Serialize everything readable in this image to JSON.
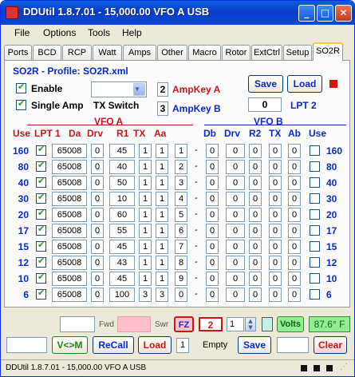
{
  "window": {
    "title": "DDUtil 1.8.7.01 - 15,000.00  VFO A  USB",
    "min": "_",
    "max": "□",
    "close": "✕"
  },
  "menu": [
    "File",
    "Options",
    "Tools",
    "Help"
  ],
  "tabs": [
    "Ports",
    "BCD",
    "RCP",
    "Watt",
    "Amps",
    "Other",
    "Macro",
    "Rotor",
    "ExtCtrl",
    "Setup",
    "SO2R"
  ],
  "so2r": {
    "profile": "SO2R - Profile: SO2R.xml",
    "enable": "Enable",
    "single_amp": "Single Amp",
    "tx_switch": "TX Switch",
    "ampkey_a_num": "2",
    "ampkey_a": "AmpKey A",
    "ampkey_b_num": "3",
    "ampkey_b": "AmpKey B",
    "save": "Save",
    "load": "Load",
    "lpt_value": "0",
    "lpt_label": "LPT 2",
    "vfo_a": "VFO A",
    "vfo_b": "VFO B",
    "headers_a": [
      "Use",
      "LPT 1",
      "Da",
      "Drv",
      "R1",
      "TX",
      "Aa"
    ],
    "headers_b": [
      "Db",
      "Drv",
      "R2",
      "TX",
      "Ab",
      "Use"
    ],
    "rows": [
      {
        "band": "160",
        "lpt": "65008",
        "da": "0",
        "drv": "45",
        "r1": "1",
        "tx": "1",
        "aa": "1",
        "db": "0",
        "drv_b": "0",
        "r2": "0",
        "tx_b": "0",
        "ab": "0",
        "band_r": "160"
      },
      {
        "band": "80",
        "lpt": "65008",
        "da": "0",
        "drv": "40",
        "r1": "1",
        "tx": "1",
        "aa": "2",
        "db": "0",
        "drv_b": "0",
        "r2": "0",
        "tx_b": "0",
        "ab": "0",
        "band_r": "80"
      },
      {
        "band": "40",
        "lpt": "65008",
        "da": "0",
        "drv": "50",
        "r1": "1",
        "tx": "1",
        "aa": "3",
        "db": "0",
        "drv_b": "0",
        "r2": "0",
        "tx_b": "0",
        "ab": "0",
        "band_r": "40"
      },
      {
        "band": "30",
        "lpt": "65008",
        "da": "0",
        "drv": "10",
        "r1": "1",
        "tx": "1",
        "aa": "4",
        "db": "0",
        "drv_b": "0",
        "r2": "0",
        "tx_b": "0",
        "ab": "0",
        "band_r": "30"
      },
      {
        "band": "20",
        "lpt": "65008",
        "da": "0",
        "drv": "60",
        "r1": "1",
        "tx": "1",
        "aa": "5",
        "db": "0",
        "drv_b": "0",
        "r2": "0",
        "tx_b": "0",
        "ab": "0",
        "band_r": "20"
      },
      {
        "band": "17",
        "lpt": "65008",
        "da": "0",
        "drv": "55",
        "r1": "1",
        "tx": "1",
        "aa": "6",
        "db": "0",
        "drv_b": "0",
        "r2": "0",
        "tx_b": "0",
        "ab": "0",
        "band_r": "17"
      },
      {
        "band": "15",
        "lpt": "65008",
        "da": "0",
        "drv": "45",
        "r1": "1",
        "tx": "1",
        "aa": "7",
        "db": "0",
        "drv_b": "0",
        "r2": "0",
        "tx_b": "0",
        "ab": "0",
        "band_r": "15"
      },
      {
        "band": "12",
        "lpt": "65008",
        "da": "0",
        "drv": "43",
        "r1": "1",
        "tx": "1",
        "aa": "8",
        "db": "0",
        "drv_b": "0",
        "r2": "0",
        "tx_b": "0",
        "ab": "0",
        "band_r": "12"
      },
      {
        "band": "10",
        "lpt": "65008",
        "da": "0",
        "drv": "45",
        "r1": "1",
        "tx": "1",
        "aa": "9",
        "db": "0",
        "drv_b": "0",
        "r2": "0",
        "tx_b": "0",
        "ab": "0",
        "band_r": "10"
      },
      {
        "band": "6",
        "lpt": "65008",
        "da": "0",
        "drv": "100",
        "r1": "3",
        "tx": "3",
        "aa": "0",
        "db": "0",
        "drv_b": "0",
        "r2": "0",
        "tx_b": "0",
        "ab": "0",
        "band_r": "6"
      }
    ]
  },
  "bottom": {
    "fwd": "Fwd",
    "swr": "Swr",
    "fz": "FZ",
    "num": "2",
    "spin": "1",
    "volts": "Volts",
    "temp": "87.6° F",
    "vm": "V<>M",
    "recall": "ReCall",
    "load": "Load",
    "mem": "1",
    "empty": "Empty",
    "save": "Save",
    "clear": "Clear"
  },
  "status": "DDUtil 1.8.7.01 - 15,000.00  VFO A  USB"
}
